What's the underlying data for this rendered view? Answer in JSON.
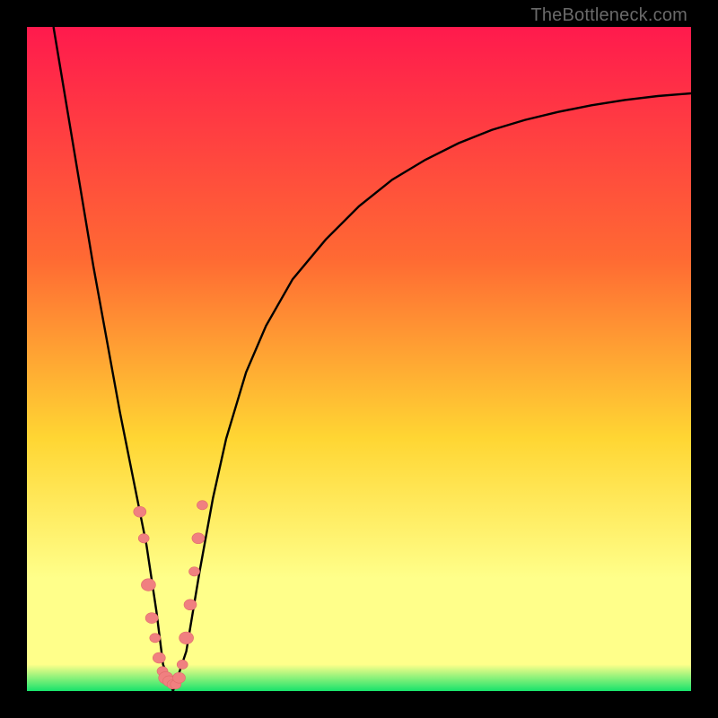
{
  "watermark": "TheBottleneck.com",
  "colors": {
    "frame": "#000000",
    "grad_top": "#ff1a4d",
    "grad_mid1": "#ff6a33",
    "grad_mid2": "#ffd633",
    "grad_yellowband": "#ffff8a",
    "grad_green": "#17e36b",
    "curve": "#000000",
    "marker_fill": "#f08080",
    "marker_stroke": "#e06a6a"
  },
  "chart_data": {
    "type": "line",
    "title": "",
    "xlabel": "",
    "ylabel": "",
    "xlim": [
      0,
      100
    ],
    "ylim": [
      0,
      100
    ],
    "grid": false,
    "legend": false,
    "series": [
      {
        "name": "bottleneck-curve",
        "x": [
          4,
          6,
          8,
          10,
          12,
          14,
          16,
          18,
          19.5,
          20.5,
          22,
          24,
          26,
          28,
          30,
          33,
          36,
          40,
          45,
          50,
          55,
          60,
          65,
          70,
          75,
          80,
          85,
          90,
          95,
          100
        ],
        "y": [
          100,
          88,
          76,
          64,
          53,
          42,
          32,
          22,
          12,
          4,
          0,
          6,
          18,
          29,
          38,
          48,
          55,
          62,
          68,
          73,
          77,
          80,
          82.5,
          84.5,
          86,
          87.2,
          88.2,
          89,
          89.6,
          90
        ]
      }
    ],
    "markers": [
      {
        "x": 17.0,
        "y": 27,
        "r": 7
      },
      {
        "x": 17.6,
        "y": 23,
        "r": 6
      },
      {
        "x": 18.3,
        "y": 16,
        "r": 8
      },
      {
        "x": 18.8,
        "y": 11,
        "r": 7
      },
      {
        "x": 19.3,
        "y": 8,
        "r": 6
      },
      {
        "x": 19.9,
        "y": 5,
        "r": 7
      },
      {
        "x": 20.4,
        "y": 3,
        "r": 6
      },
      {
        "x": 20.9,
        "y": 2,
        "r": 8
      },
      {
        "x": 21.4,
        "y": 1.5,
        "r": 7
      },
      {
        "x": 21.9,
        "y": 1,
        "r": 6
      },
      {
        "x": 22.4,
        "y": 1,
        "r": 6
      },
      {
        "x": 22.9,
        "y": 2,
        "r": 7
      },
      {
        "x": 23.4,
        "y": 4,
        "r": 6
      },
      {
        "x": 24.0,
        "y": 8,
        "r": 8
      },
      {
        "x": 24.6,
        "y": 13,
        "r": 7
      },
      {
        "x": 25.2,
        "y": 18,
        "r": 6
      },
      {
        "x": 25.8,
        "y": 23,
        "r": 7
      },
      {
        "x": 26.4,
        "y": 28,
        "r": 6
      }
    ]
  }
}
